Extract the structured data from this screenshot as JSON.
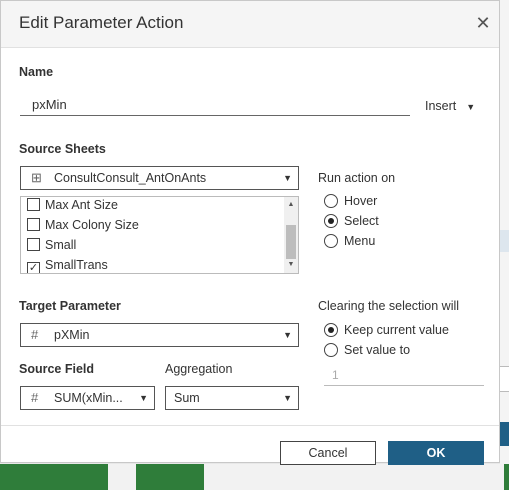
{
  "dialog": {
    "title": "Edit Parameter Action",
    "close_icon": "close-icon"
  },
  "name": {
    "label": "Name",
    "value": "pxMin",
    "insert_label": "Insert",
    "insert_caret": "▼"
  },
  "source_sheets": {
    "label": "Source Sheets",
    "selected": "ConsultConsult_AntOnAnts",
    "icon": "grid-icon",
    "items": [
      {
        "label": "Max Ant Size",
        "checked": false
      },
      {
        "label": "Max Colony Size",
        "checked": false
      },
      {
        "label": "Small",
        "checked": false
      },
      {
        "label": "SmallTrans",
        "checked": true
      }
    ]
  },
  "run_action": {
    "label": "Run action on",
    "options": [
      {
        "label": "Hover",
        "selected": false
      },
      {
        "label": "Select",
        "selected": true
      },
      {
        "label": "Menu",
        "selected": false
      }
    ]
  },
  "target_parameter": {
    "label": "Target Parameter",
    "value": "pXMin",
    "icon": "hash-icon"
  },
  "clearing": {
    "label": "Clearing the selection will",
    "options": [
      {
        "label": "Keep current value",
        "selected": true
      },
      {
        "label": "Set value to",
        "selected": false
      }
    ],
    "set_value": "1"
  },
  "source_field": {
    "label": "Source Field",
    "value": "SUM(xMin...",
    "icon": "hash-icon"
  },
  "aggregation": {
    "label": "Aggregation",
    "value": "Sum"
  },
  "buttons": {
    "cancel": "Cancel",
    "ok": "OK"
  },
  "colors": {
    "primary": "#1f5f86",
    "background_green": "#2f7d3a"
  }
}
